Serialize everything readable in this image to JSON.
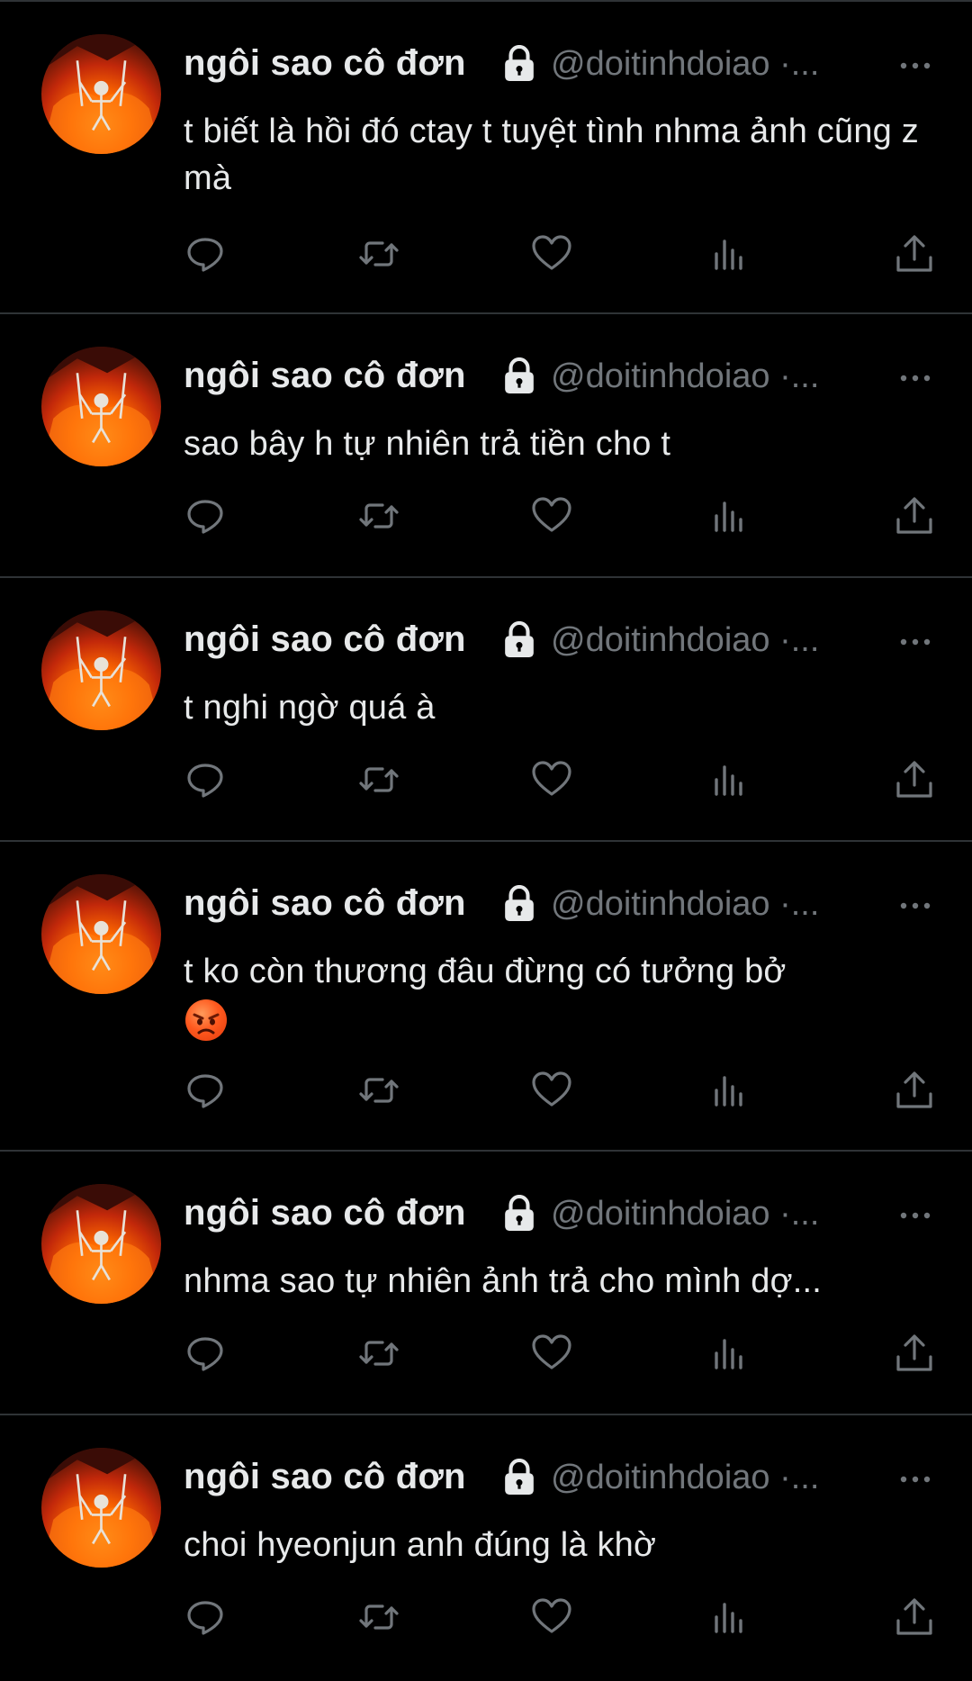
{
  "profile": {
    "display_name": "ngôi sao cô đơn",
    "handle": "@doitinhdoiao ·..."
  },
  "colors": {
    "background": "#000000",
    "divider": "#2f3336",
    "text": "#e7e9ea",
    "muted": "#71767b"
  },
  "icons": {
    "lock": "lock-icon",
    "more": "more-icon",
    "reply": "reply-icon",
    "retweet": "retweet-icon",
    "like": "heart-icon",
    "views": "views-icon",
    "share": "share-icon",
    "emoji": "angry-face-emoji"
  },
  "tweets": [
    {
      "text": "t biết là hồi đó ctay t tuyệt tình nhma ảnh cũng z mà"
    },
    {
      "text": "sao bây h tự nhiên trả tiền cho t"
    },
    {
      "text": "t nghi ngờ quá à"
    },
    {
      "text": "t ko còn thương đâu đừng có tưởng bở"
    },
    {
      "text": "nhma sao tự nhiên ảnh trả cho mình dợ..."
    },
    {
      "text": "choi hyeonjun anh đúng là khờ"
    }
  ]
}
